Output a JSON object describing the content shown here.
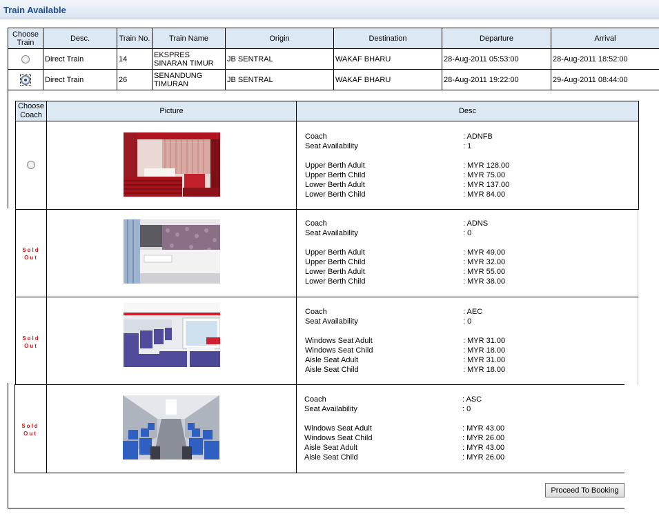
{
  "page": {
    "title": "Train Available"
  },
  "train_table": {
    "headers": [
      "Choose Train",
      "Desc.",
      "Train No.",
      "Train Name",
      "Origin",
      "Destination",
      "Departure",
      "Arrival"
    ],
    "rows": [
      {
        "selected": false,
        "desc": "Direct Train",
        "train_no": "14",
        "train_name": "EKSPRES SINARAN TIMUR",
        "origin": "JB SENTRAL",
        "destination": "WAKAF BHARU",
        "departure": "28-Aug-2011 05:53:00",
        "arrival": "28-Aug-2011 18:52:00"
      },
      {
        "selected": true,
        "desc": "Direct Train",
        "train_no": "26",
        "train_name": "SENANDUNG TIMURAN",
        "origin": "JB SENTRAL",
        "destination": "WAKAF BHARU",
        "departure": "28-Aug-2011 19:22:00",
        "arrival": "29-Aug-2011 08:44:00"
      }
    ]
  },
  "coach_table": {
    "headers": {
      "choose": "Choose Coach",
      "picture": "Picture",
      "desc": "Desc"
    },
    "sold_out_label": "Sold Out",
    "coaches": [
      {
        "available": true,
        "fields": [
          {
            "k": "Coach",
            "v": ": ADNFB"
          },
          {
            "k": "Seat Availability",
            "v": ": 1"
          }
        ],
        "prices": [
          {
            "k": "Upper Berth Adult",
            "v": ": MYR 128.00"
          },
          {
            "k": "Upper Berth Child",
            "v": ": MYR 75.00"
          },
          {
            "k": "Lower Berth Adult",
            "v": ": MYR 137.00"
          },
          {
            "k": "Lower Berth Child",
            "v": ": MYR 84.00"
          }
        ]
      },
      {
        "available": false,
        "fields": [
          {
            "k": "Coach",
            "v": ": ADNS"
          },
          {
            "k": "Seat Availability",
            "v": ": 0"
          }
        ],
        "prices": [
          {
            "k": "Upper Berth Adult",
            "v": ": MYR 49.00"
          },
          {
            "k": "Upper Berth Child",
            "v": ": MYR 32.00"
          },
          {
            "k": "Lower Berth Adult",
            "v": ": MYR 55.00"
          },
          {
            "k": "Lower Berth Child",
            "v": ": MYR 38.00"
          }
        ]
      },
      {
        "available": false,
        "fields": [
          {
            "k": "Coach",
            "v": ": AEC"
          },
          {
            "k": "Seat Availability",
            "v": ": 0"
          }
        ],
        "prices": [
          {
            "k": "Windows Seat Adult",
            "v": ": MYR 31.00"
          },
          {
            "k": "Windows Seat Child",
            "v": ": MYR 18.00"
          },
          {
            "k": "Aisle Seat Adult",
            "v": ": MYR 31.00"
          },
          {
            "k": "Aisle Seat Child",
            "v": ": MYR 18.00"
          }
        ]
      },
      {
        "available": false,
        "fields": [
          {
            "k": "Coach",
            "v": ": ASC"
          },
          {
            "k": "Seat Availability",
            "v": ": 0"
          }
        ],
        "prices": [
          {
            "k": "Windows Seat Adult",
            "v": ": MYR 43.00"
          },
          {
            "k": "Windows Seat Child",
            "v": ": MYR 26.00"
          },
          {
            "k": "Aisle Seat Adult",
            "v": ": MYR 43.00"
          },
          {
            "k": "Aisle Seat Child",
            "v": ": MYR 26.00"
          }
        ]
      }
    ]
  },
  "actions": {
    "proceed_label": "Proceed To Booking"
  }
}
